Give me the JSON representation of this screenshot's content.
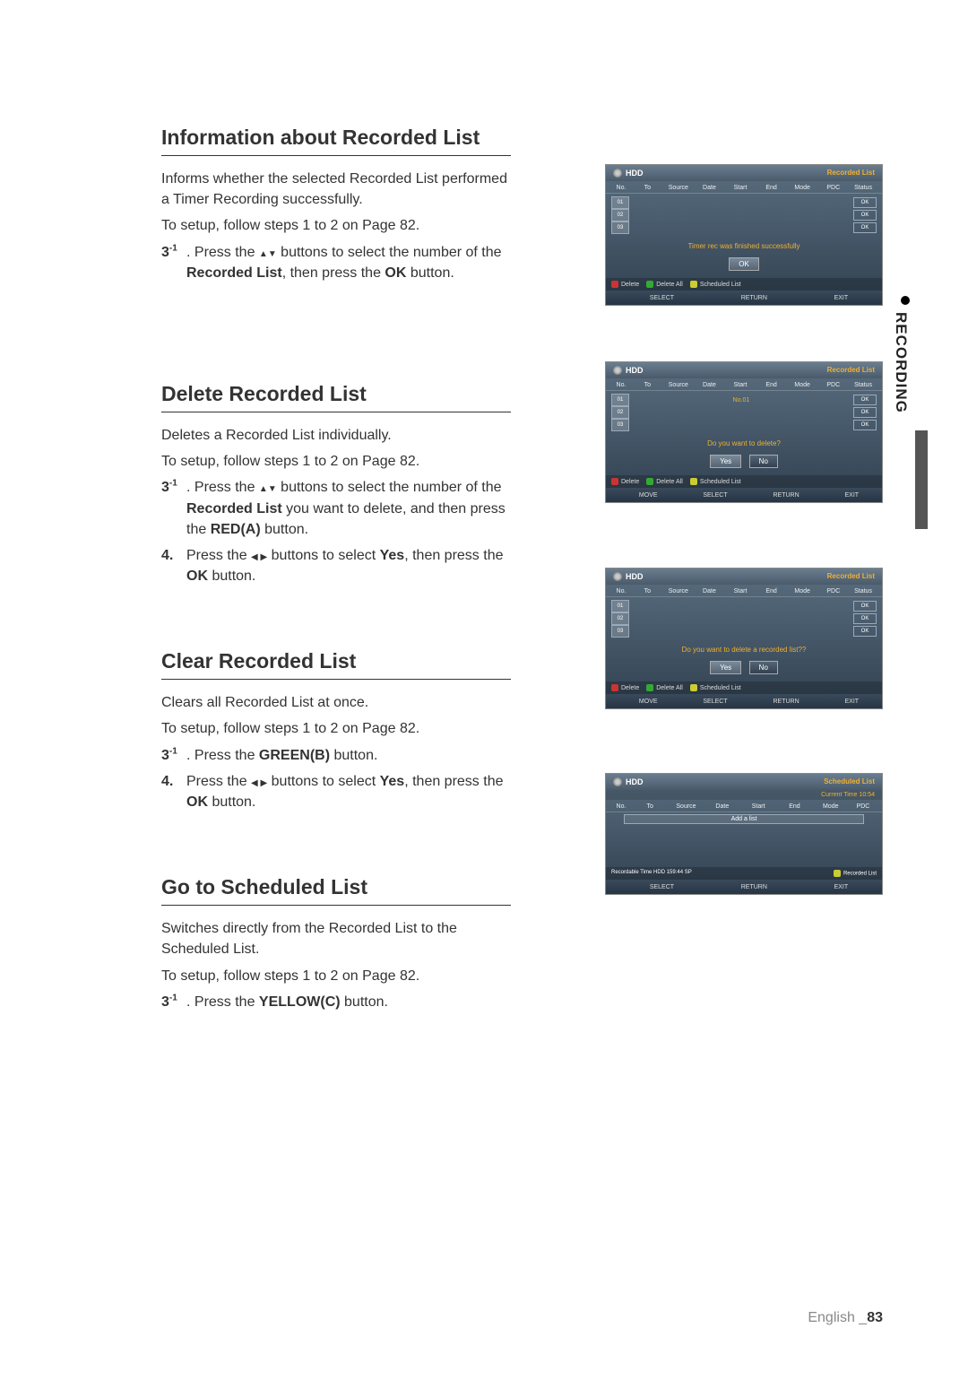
{
  "sideTab": "RECORDING",
  "footer": {
    "lang": "English",
    "sep": "_",
    "page": "83"
  },
  "s1": {
    "title": "Information about Recorded List",
    "p1": "Informs whether the selected Recorded List performed a Timer Recording successfully.",
    "p2": "To setup, follow steps 1 to 2 on Page 82.",
    "step31_num": "3",
    "step31_sup": "-1",
    "step31_a": ". Press the ",
    "step31_arrows": "▲▼",
    "step31_b": " buttons to select the number of the ",
    "step31_bold1": "Recorded List",
    "step31_c": ", then press the ",
    "step31_bold2": "OK",
    "step31_d": " button."
  },
  "s2": {
    "title": "Delete Recorded List",
    "p1": "Deletes a Recorded List individually.",
    "p2": "To setup, follow steps 1 to 2 on Page 82.",
    "step31_num": "3",
    "step31_sup": "-1",
    "step31_a": ". Press the ",
    "step31_arrows": "▲▼",
    "step31_b": " buttons to select the number of the ",
    "step31_bold1": "Recorded List",
    "step31_c": " you want to delete, and then press the ",
    "step31_bold2": "RED(A)",
    "step31_d": " button.",
    "step4_num": "4.",
    "step4_a": " Press the ",
    "step4_arrows": "◀ ▶",
    "step4_b": " buttons to select ",
    "step4_bold1": "Yes",
    "step4_c": ", then press the ",
    "step4_bold2": "OK",
    "step4_d": " button."
  },
  "s3": {
    "title": "Clear Recorded List",
    "p1": "Clears all Recorded List at once.",
    "p2": "To setup, follow steps 1 to 2 on Page 82.",
    "step31_num": "3",
    "step31_sup": "-1",
    "step31_a": ". Press the ",
    "step31_bold1": "GREEN(B)",
    "step31_b": " button.",
    "step4_num": "4.",
    "step4_a": " Press the ",
    "step4_arrows": "◀ ▶",
    "step4_b": " buttons to select ",
    "step4_bold1": "Yes",
    "step4_c": ", then press the ",
    "step4_bold2": "OK",
    "step4_d": " button."
  },
  "s4": {
    "title": "Go to Scheduled List",
    "p1": "Switches directly from the Recorded List to the Scheduled List.",
    "p2": "To setup, follow steps 1 to 2 on Page 82.",
    "step31_num": "3",
    "step31_sup": "-1",
    "step31_a": ". Press the ",
    "step31_bold1": "YELLOW(C)",
    "step31_b": " button."
  },
  "ui": {
    "hdd": "HDD",
    "recorded_list": "Recorded List",
    "scheduled_list": "Scheduled List",
    "cols": {
      "no": "No.",
      "to": "To",
      "source": "Source",
      "date": "Date",
      "start": "Start",
      "end": "End",
      "mode": "Mode",
      "pdc": "PDC",
      "status": "Status"
    },
    "rows": {
      "r1": "01",
      "r2": "02",
      "r3": "03",
      "ok": "OK"
    },
    "msg_info": "Timer rec was finished successfully",
    "msg_del_title": "No.01",
    "msg_del": "Do you want to delete?",
    "msg_clear": "Do you want to delete a recorded list??",
    "btn_ok": "OK",
    "btn_yes": "Yes",
    "btn_no": "No",
    "act_delete": "Delete",
    "act_delete_all": "Delete All",
    "act_sched": "Scheduled List",
    "act_rec": "Recorded List",
    "foot_move": "MOVE",
    "foot_select": "SELECT",
    "foot_return": "RETURN",
    "foot_exit": "EXIT",
    "current_time": "Current Time 10:54",
    "add_list": "Add a list",
    "rec_time": "Recordable Time  HDD 159:44 SP"
  }
}
